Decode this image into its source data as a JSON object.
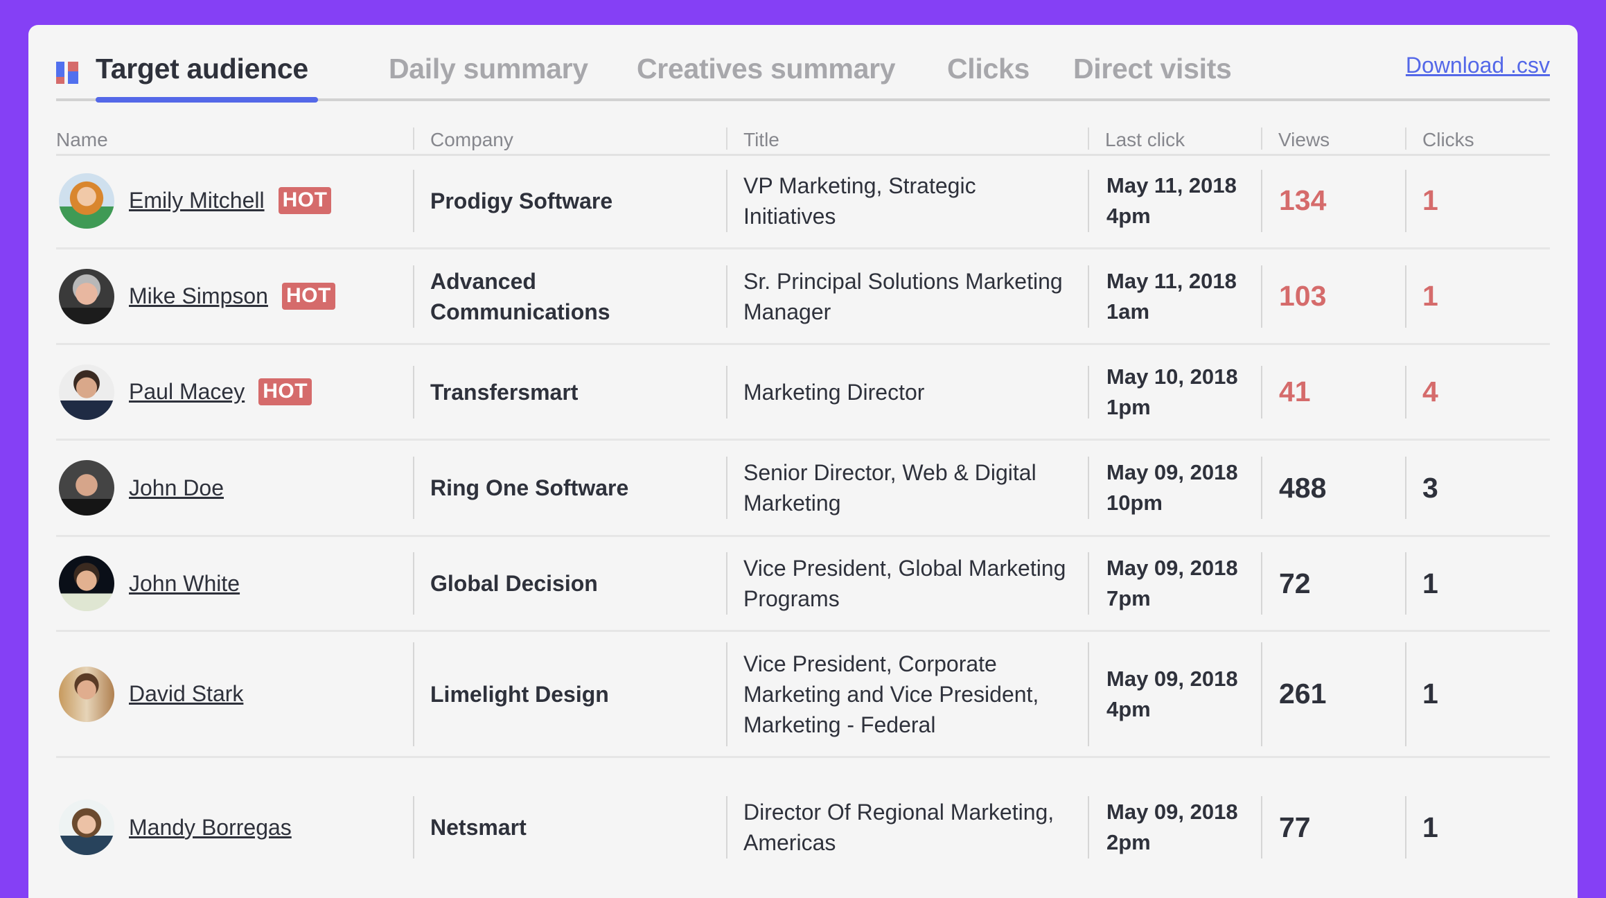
{
  "tabs": [
    {
      "label": "Target audience",
      "active": true
    },
    {
      "label": "Daily summary",
      "active": false
    },
    {
      "label": "Creatives summary",
      "active": false
    },
    {
      "label": "Clicks",
      "active": false
    },
    {
      "label": "Direct visits",
      "active": false
    }
  ],
  "download_label": "Download .csv",
  "logo_icon": "dashboard-grid-icon",
  "colors": {
    "background": "#8540F5",
    "accent": "#5468E8",
    "hot": "#D56B6B",
    "text": "#2E313B",
    "muted": "#A7A7AB"
  },
  "table": {
    "columns": [
      "Name",
      "Company",
      "Title",
      "Last click",
      "Views",
      "Clicks"
    ],
    "rows": [
      {
        "name": "Emily Mitchell",
        "hot": true,
        "hot_label": "HOT",
        "company": "Prodigy Software",
        "title": "VP Marketing, Strategic Initiatives",
        "last_click": "May 11, 2018 4pm",
        "views": "134",
        "clicks": "1"
      },
      {
        "name": "Mike Simpson",
        "hot": true,
        "hot_label": "HOT",
        "company": "Advanced Communications",
        "title": "Sr. Principal Solutions Marketing Manager",
        "last_click": "May 11, 2018 1am",
        "views": "103",
        "clicks": "1"
      },
      {
        "name": "Paul Macey",
        "hot": true,
        "hot_label": "HOT",
        "company": "Transfersmart",
        "title": "Marketing Director",
        "last_click": "May 10, 2018 1pm",
        "views": "41",
        "clicks": "4"
      },
      {
        "name": "John Doe",
        "hot": false,
        "company": "Ring One Software",
        "title": "Senior Director, Web & Digital Marketing",
        "last_click": "May 09, 2018 10pm",
        "views": "488",
        "clicks": "3"
      },
      {
        "name": "John White",
        "hot": false,
        "company": "Global Decision",
        "title": "Vice President, Global Marketing Programs",
        "last_click": "May 09, 2018 7pm",
        "views": "72",
        "clicks": "1"
      },
      {
        "name": "David Stark",
        "hot": false,
        "company": "Limelight Design",
        "title": "Vice President, Corporate Marketing and Vice President, Marketing - Federal",
        "last_click": "May 09, 2018 4pm",
        "views": "261",
        "clicks": "1"
      },
      {
        "name": "Mandy Borregas",
        "hot": false,
        "company": "Netsmart",
        "title": "Director Of Regional Marketing, Americas",
        "last_click": "May 09, 2018 2pm",
        "views": "77",
        "clicks": "1"
      }
    ]
  }
}
